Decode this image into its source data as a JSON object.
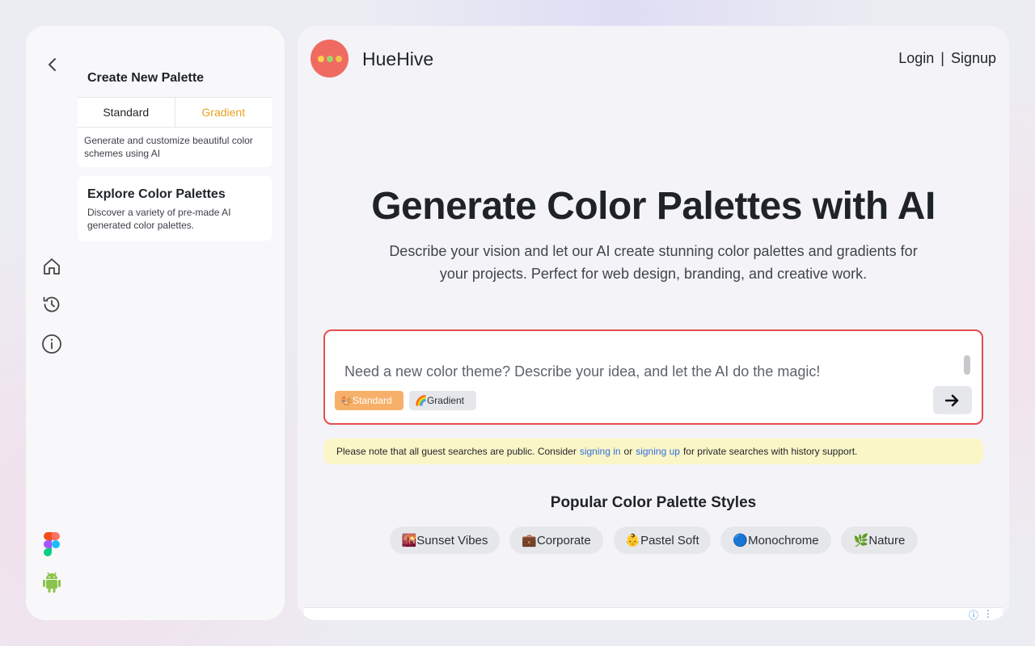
{
  "sidebar": {
    "create": {
      "title": "Create New Palette",
      "tabs": [
        "Standard",
        "Gradient"
      ],
      "active_tab": "Gradient",
      "description": "Generate and customize beautiful color schemes using AI"
    },
    "explore": {
      "title": "Explore Color Palettes",
      "description": "Discover a variety of pre-made AI generated color palettes."
    },
    "nav_icons": [
      "home-icon",
      "history-icon",
      "info-icon"
    ],
    "bottom_icons": [
      "figma-icon",
      "android-icon"
    ]
  },
  "header": {
    "brand": "HueHive",
    "login": "Login",
    "separator": "|",
    "signup": "Signup"
  },
  "hero": {
    "title": "Generate Color Palettes with AI",
    "subtitle": "Describe your vision and let our AI create stunning color palettes and gradients for your projects. Perfect for web design, branding, and creative work."
  },
  "prompt": {
    "placeholder": "Need a new color theme? Describe your idea, and let the AI do the magic!",
    "value": "",
    "chip_standard": "🎨Standard",
    "chip_gradient": "🌈Gradient"
  },
  "notice": {
    "text_before": "Please note that all guest searches are public. Consider",
    "link_signin": "signing in",
    "text_or": "or",
    "link_signup": "signing up",
    "text_after": "for private searches with history support."
  },
  "popular": {
    "title": "Popular Color Palette Styles",
    "styles": [
      "🌇Sunset Vibes",
      "💼Corporate",
      "👶Pastel Soft",
      "🔵Monochrome",
      "🌿Nature"
    ]
  },
  "colors": {
    "accent_red": "#e44f4f",
    "gradient_tab": "#e9a223",
    "chip_standard": "#f6b06a",
    "notice_bg": "#fbf6c7",
    "link": "#2f6ee0",
    "logo": "#ef6b62"
  }
}
